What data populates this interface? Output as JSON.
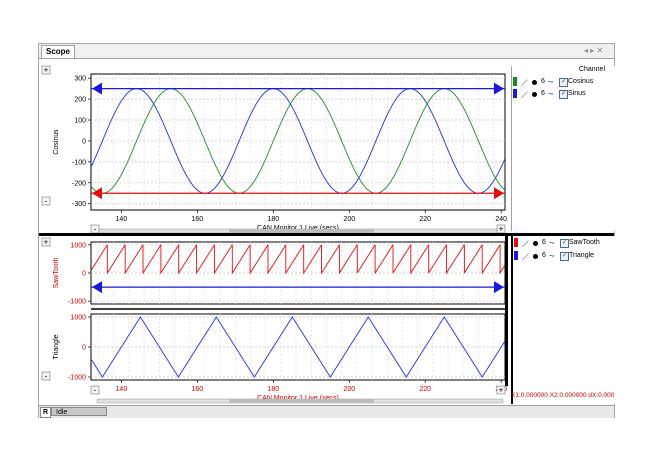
{
  "window": {
    "tab_label": "Scope",
    "tab_controls": "◂ ▸ ✕"
  },
  "status": {
    "r_label": "R",
    "state": "Idle",
    "cursor_readout": "X1:0.000000 X2:0.000000 dX:0.000"
  },
  "legends": {
    "top": {
      "header": "Channel",
      "rows": [
        {
          "name": "Cosinus",
          "color": "#1a8a1a",
          "width": "6"
        },
        {
          "name": "Sinus",
          "color": "#1a1ad8",
          "width": "6"
        }
      ]
    },
    "bottom": {
      "rows": [
        {
          "name": "SawTooth",
          "color": "#e01010",
          "width": "6"
        },
        {
          "name": "Triangle",
          "color": "#1a1ad8",
          "width": "6"
        }
      ]
    }
  },
  "colors": {
    "sinus": "#2030e0",
    "cosinus": "#228b22",
    "sawtooth": "#e01010",
    "triangle": "#2030e0",
    "cursor_upper": "#1a1ad8",
    "cursor_lower": "#e01010"
  },
  "chart_data": [
    {
      "type": "line",
      "title": "",
      "xlabel": "CAN Monitor 1 Live (secs)",
      "ylabel": "Cosinus",
      "xlim": [
        132,
        241
      ],
      "ylim": [
        -330,
        320
      ],
      "xticks": [
        140,
        160,
        180,
        200,
        220,
        240
      ],
      "yticks": [
        300,
        200,
        100,
        0,
        -100,
        -200,
        -300
      ],
      "grid": true,
      "cursors": [
        250,
        -250
      ],
      "series": [
        {
          "name": "Sinus",
          "function": "sin",
          "amplitude": 250,
          "period": 36,
          "phase_zero_x": 135,
          "color": "#2030e0"
        },
        {
          "name": "Cosinus",
          "function": "sin",
          "amplitude": 250,
          "period": 36,
          "phase_zero_x": 144,
          "color": "#228b22"
        }
      ]
    },
    {
      "type": "line",
      "title": "",
      "xlabel": "",
      "ylabel": "SawTooth",
      "xlim": [
        132,
        241
      ],
      "ylim": [
        -1100,
        1100
      ],
      "yticks": [
        1000,
        0,
        -1000
      ],
      "grid": true,
      "cursors": [
        -500
      ],
      "series": [
        {
          "name": "SawTooth",
          "function": "sawtooth",
          "min": 0,
          "max": 1000,
          "period": 4.7,
          "color": "#e01010"
        }
      ]
    },
    {
      "type": "line",
      "title": "",
      "xlabel": "CAN Monitor 1 Live (secs)",
      "ylabel": "Triangle",
      "xlim": [
        132,
        241
      ],
      "ylim": [
        -1100,
        1100
      ],
      "xticks": [
        140,
        160,
        180,
        200,
        220,
        240
      ],
      "yticks": [
        1000,
        0,
        -1000
      ],
      "grid": true,
      "series": [
        {
          "name": "Triangle",
          "function": "triangle",
          "min": -1000,
          "max": 1000,
          "period": 20,
          "peak_x": 145,
          "color": "#2030e0"
        }
      ]
    }
  ]
}
